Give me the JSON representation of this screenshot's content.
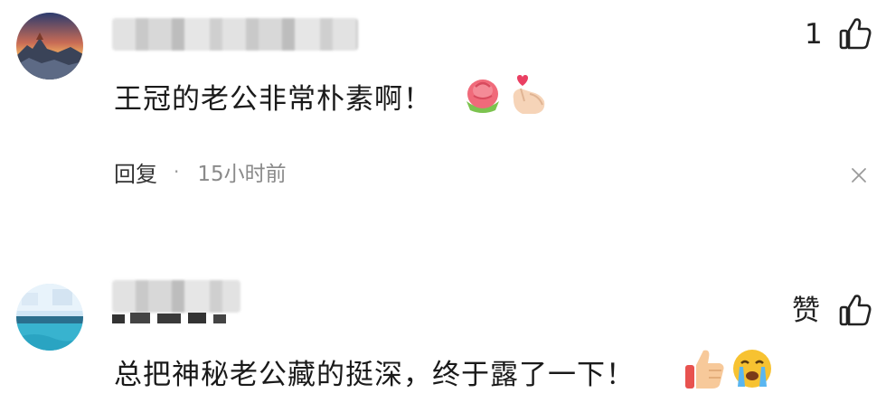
{
  "comments": [
    {
      "text": "王冠的老公非常朴素啊！",
      "like_label": "1",
      "reply_label": "回复",
      "separator": "·",
      "time": "15小时前",
      "emojis": [
        "rose-emoji",
        "heart-hand-emoji"
      ]
    },
    {
      "text": "总把神秘老公藏的挺深，终于露了一下！",
      "like_label": "赞",
      "emojis": [
        "thumbs-up-emoji",
        "crying-face-emoji"
      ]
    }
  ],
  "icons": {
    "like": "thumbs-up-outline-icon",
    "close": "close-icon"
  }
}
